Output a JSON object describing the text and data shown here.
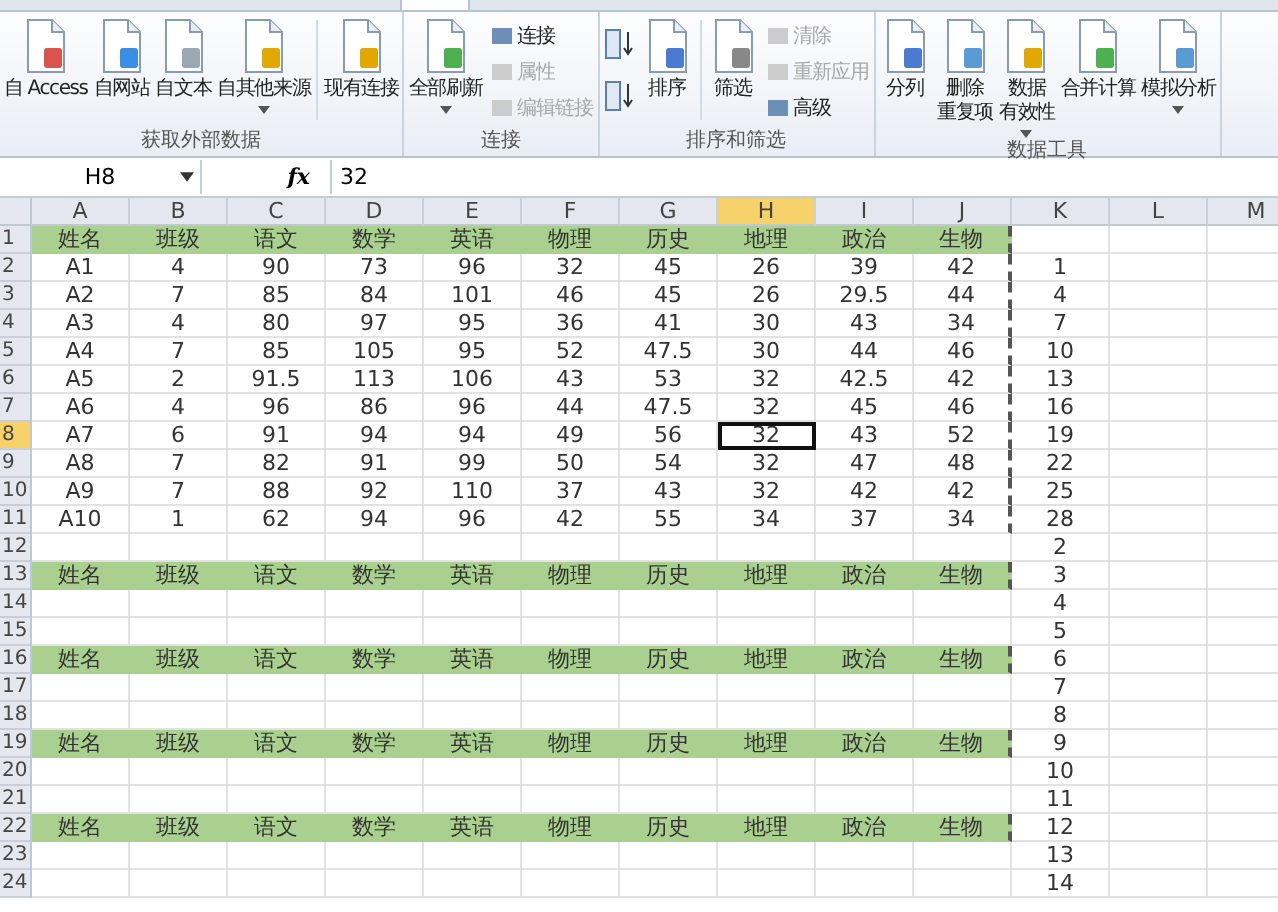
{
  "ribbon": {
    "groups": [
      {
        "label": "获取外部数据",
        "items": [
          {
            "kind": "large",
            "lines": [
              "自 Access"
            ]
          },
          {
            "kind": "large",
            "lines": [
              "自网站"
            ]
          },
          {
            "kind": "large",
            "lines": [
              "自文本"
            ]
          },
          {
            "kind": "large",
            "lines": [
              "自其他来源"
            ],
            "dropdown": true
          },
          {
            "kind": "separator"
          },
          {
            "kind": "large",
            "lines": [
              "现有连接"
            ]
          }
        ]
      },
      {
        "label": "连接",
        "items": [
          {
            "kind": "large",
            "lines": [
              "全部刷新"
            ],
            "dropdown": true
          },
          {
            "kind": "stack",
            "items": [
              {
                "label": "连接",
                "disabled": false
              },
              {
                "label": "属性",
                "disabled": true
              },
              {
                "label": "编辑链接",
                "disabled": true
              }
            ]
          }
        ]
      },
      {
        "label": "排序和筛选",
        "items": [
          {
            "kind": "sorticons"
          },
          {
            "kind": "large",
            "lines": [
              "排序"
            ]
          },
          {
            "kind": "separator"
          },
          {
            "kind": "large",
            "lines": [
              "筛选"
            ]
          },
          {
            "kind": "stack",
            "items": [
              {
                "label": "清除",
                "disabled": true
              },
              {
                "label": "重新应用",
                "disabled": true
              },
              {
                "label": "高级",
                "disabled": false
              }
            ]
          }
        ]
      },
      {
        "label": "数据工具",
        "items": [
          {
            "kind": "large",
            "lines": [
              "分列"
            ]
          },
          {
            "kind": "large",
            "lines": [
              "删除",
              "重复项"
            ]
          },
          {
            "kind": "large",
            "lines": [
              "数据",
              "有效性"
            ],
            "dropdown": true
          },
          {
            "kind": "large",
            "lines": [
              "合并计算"
            ]
          },
          {
            "kind": "large",
            "lines": [
              "模拟分析"
            ],
            "dropdown": true
          }
        ]
      }
    ]
  },
  "name_box": "H8",
  "function_label": "fx",
  "formula": "32",
  "columns": [
    {
      "label": "A",
      "selected": false
    },
    {
      "label": "B",
      "selected": false
    },
    {
      "label": "C",
      "selected": false
    },
    {
      "label": "D",
      "selected": false
    },
    {
      "label": "E",
      "selected": false
    },
    {
      "label": "F",
      "selected": false
    },
    {
      "label": "G",
      "selected": false
    },
    {
      "label": "H",
      "selected": true
    },
    {
      "label": "I",
      "selected": false
    },
    {
      "label": "J",
      "selected": false
    },
    {
      "label": "K",
      "selected": false
    },
    {
      "label": "L",
      "selected": false
    },
    {
      "label": "M",
      "selected": false
    }
  ],
  "rows": [
    {
      "number": "1",
      "kind": "header",
      "selected": false,
      "cells": [
        "姓名",
        "班级",
        "语文",
        "数学",
        "英语",
        "物理",
        "历史",
        "地理",
        "政治",
        "生物"
      ]
    },
    {
      "number": "2",
      "kind": "data",
      "selected": false,
      "cells": [
        "A1",
        "4",
        "90",
        "73",
        "96",
        "32",
        "45",
        "26",
        "39",
        "42"
      ],
      "k": "1"
    },
    {
      "number": "3",
      "kind": "data",
      "selected": false,
      "cells": [
        "A2",
        "7",
        "85",
        "84",
        "101",
        "46",
        "45",
        "26",
        "29.5",
        "44"
      ],
      "k": "4"
    },
    {
      "number": "4",
      "kind": "data",
      "selected": false,
      "cells": [
        "A3",
        "4",
        "80",
        "97",
        "95",
        "36",
        "41",
        "30",
        "43",
        "34"
      ],
      "k": "7"
    },
    {
      "number": "5",
      "kind": "data",
      "selected": false,
      "cells": [
        "A4",
        "7",
        "85",
        "105",
        "95",
        "52",
        "47.5",
        "30",
        "44",
        "46"
      ],
      "k": "10"
    },
    {
      "number": "6",
      "kind": "data",
      "selected": false,
      "cells": [
        "A5",
        "2",
        "91.5",
        "113",
        "106",
        "43",
        "53",
        "32",
        "42.5",
        "42"
      ],
      "k": "13"
    },
    {
      "number": "7",
      "kind": "data",
      "selected": false,
      "cells": [
        "A6",
        "4",
        "96",
        "86",
        "96",
        "44",
        "47.5",
        "32",
        "45",
        "46"
      ],
      "k": "16"
    },
    {
      "number": "8",
      "kind": "data",
      "selected": true,
      "cells": [
        "A7",
        "6",
        "91",
        "94",
        "94",
        "49",
        "56",
        "32",
        "43",
        "52"
      ],
      "k": "19"
    },
    {
      "number": "9",
      "kind": "data",
      "selected": false,
      "cells": [
        "A8",
        "7",
        "82",
        "91",
        "99",
        "50",
        "54",
        "32",
        "47",
        "48"
      ],
      "k": "22"
    },
    {
      "number": "10",
      "kind": "data",
      "selected": false,
      "cells": [
        "A9",
        "7",
        "88",
        "92",
        "110",
        "37",
        "43",
        "32",
        "42",
        "42"
      ],
      "k": "25"
    },
    {
      "number": "11",
      "kind": "data",
      "selected": false,
      "cells": [
        "A10",
        "1",
        "62",
        "94",
        "96",
        "42",
        "55",
        "34",
        "37",
        "34"
      ],
      "k": "28"
    },
    {
      "number": "12",
      "kind": "blank",
      "selected": false,
      "k": "2"
    },
    {
      "number": "13",
      "kind": "header",
      "selected": false,
      "cells": [
        "姓名",
        "班级",
        "语文",
        "数学",
        "英语",
        "物理",
        "历史",
        "地理",
        "政治",
        "生物"
      ],
      "k": "3"
    },
    {
      "number": "14",
      "kind": "blank",
      "selected": false,
      "k": "4"
    },
    {
      "number": "15",
      "kind": "blank",
      "selected": false,
      "k": "5"
    },
    {
      "number": "16",
      "kind": "header",
      "selected": false,
      "cells": [
        "姓名",
        "班级",
        "语文",
        "数学",
        "英语",
        "物理",
        "历史",
        "地理",
        "政治",
        "生物"
      ],
      "k": "6"
    },
    {
      "number": "17",
      "kind": "blank",
      "selected": false,
      "k": "7"
    },
    {
      "number": "18",
      "kind": "blank",
      "selected": false,
      "k": "8"
    },
    {
      "number": "19",
      "kind": "header",
      "selected": false,
      "cells": [
        "姓名",
        "班级",
        "语文",
        "数学",
        "英语",
        "物理",
        "历史",
        "地理",
        "政治",
        "生物"
      ],
      "k": "9"
    },
    {
      "number": "20",
      "kind": "blank",
      "selected": false,
      "k": "10"
    },
    {
      "number": "21",
      "kind": "blank",
      "selected": false,
      "k": "11"
    },
    {
      "number": "22",
      "kind": "header",
      "selected": false,
      "cells": [
        "姓名",
        "班级",
        "语文",
        "数学",
        "英语",
        "物理",
        "历史",
        "地理",
        "政治",
        "生物"
      ],
      "k": "12"
    },
    {
      "number": "23",
      "kind": "blank",
      "selected": false,
      "k": "13"
    },
    {
      "number": "24",
      "kind": "blank",
      "selected": false,
      "k": "14"
    }
  ]
}
